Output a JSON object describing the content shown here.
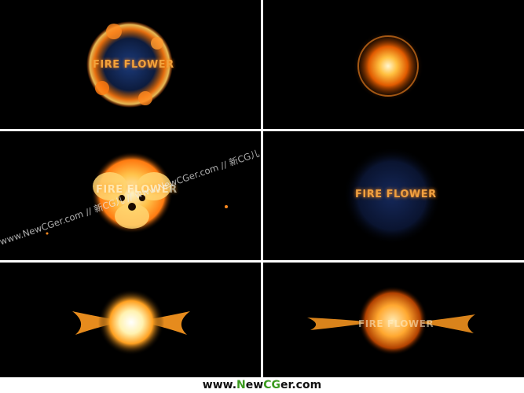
{
  "frames": {
    "frame1_title": "FIRE FLOWER",
    "frame3_title": "FIRE FLOWER",
    "frame4_title": "FIRE FLOWER",
    "frame6_title": "FIRE FLOWER"
  },
  "watermark": {
    "text": "www.NewCGer.com // 新CG儿 // www.NewCGer.com // 新CG儿"
  },
  "footer": {
    "prefix": "www.",
    "n": "N",
    "ew": "ew",
    "cg": "CG",
    "er": "er",
    "suffix": ".com"
  },
  "colors": {
    "fire_orange": "#ff8c1a",
    "fire_core": "#fff4c8",
    "accent_green": "#3a9a1e"
  }
}
